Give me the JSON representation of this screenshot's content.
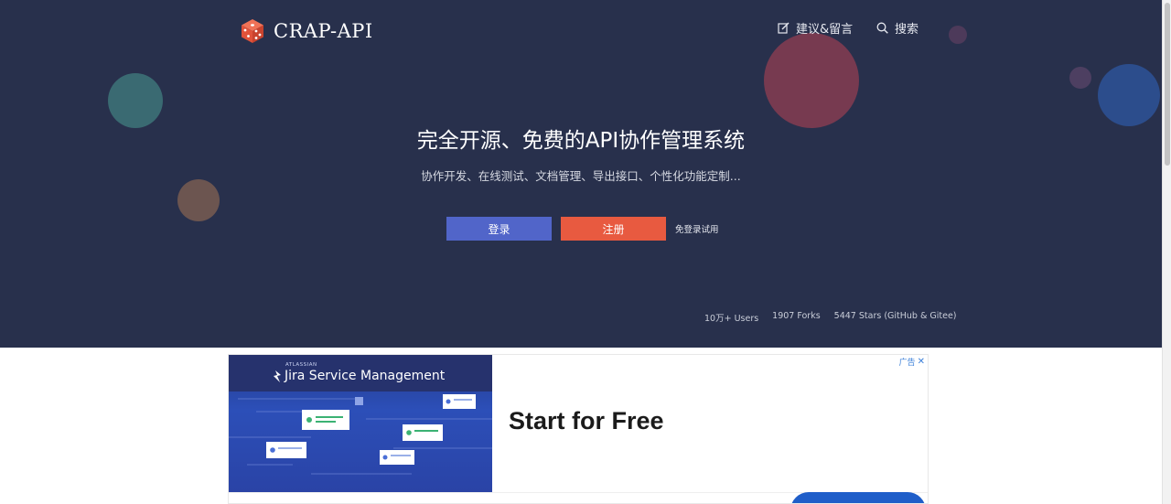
{
  "brand": {
    "name": "CRAP-API",
    "icon": "dice-icon",
    "icon_color": "#e85a40"
  },
  "nav": {
    "feedback_label": "建议&留言",
    "feedback_icon": "edit-icon",
    "search_label": "搜索",
    "search_icon": "search-icon"
  },
  "hero": {
    "title": "完全开源、免费的API协作管理系统",
    "subtitle": "协作开发、在线测试、文档管理、导出接口、个性化功能定制...",
    "background": "#28304c"
  },
  "buttons": {
    "login_label": "登录",
    "login_color": "#5165c9",
    "register_label": "注册",
    "register_color": "#e85a40",
    "trial_label": "免登录试用"
  },
  "stats": {
    "users": "10万+ Users",
    "forks": "1907 Forks",
    "stars": "5447 Stars (GitHub & Gitee)"
  },
  "ad": {
    "brand_small": "ATLASSIAN",
    "brand": "Jira Service Management",
    "headline": "Start for Free",
    "badge_label": "广告",
    "badge_close": "✕"
  }
}
